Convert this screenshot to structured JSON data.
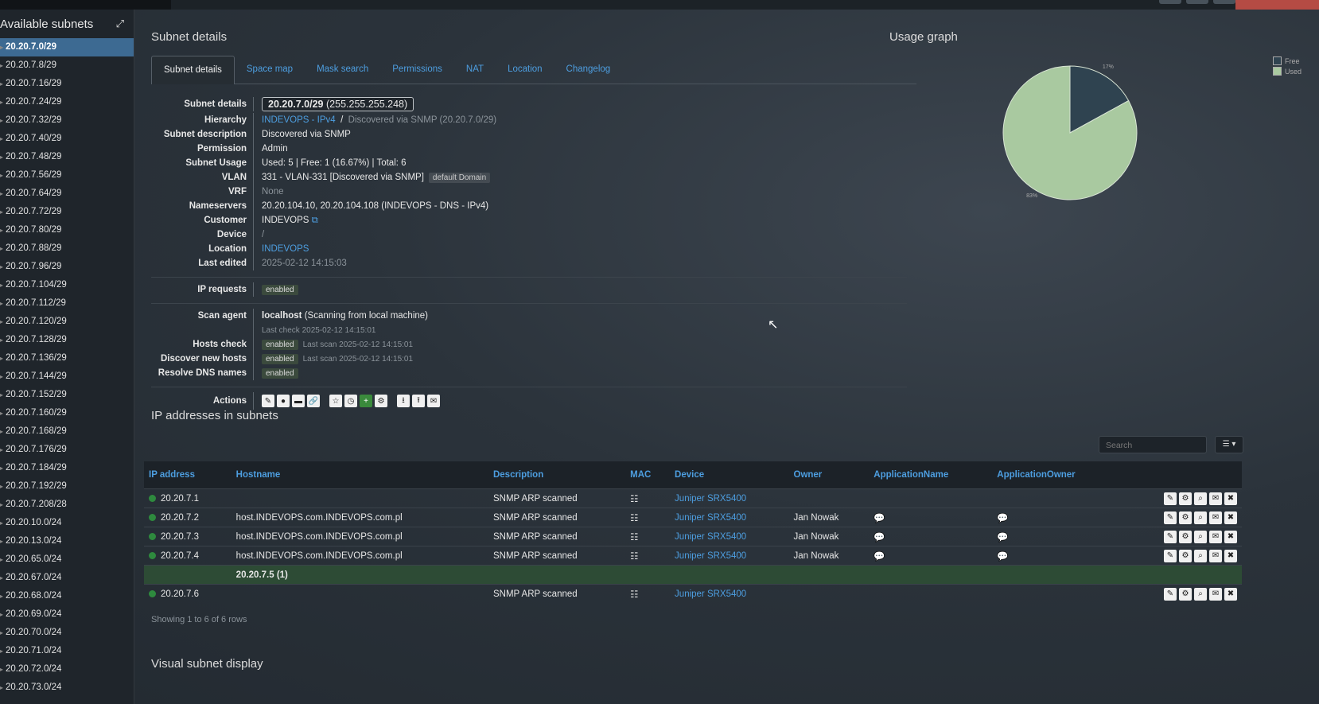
{
  "sidebar": {
    "title": "Available subnets",
    "expand_icon": "expand-icon",
    "subnets": [
      "20.20.7.0/29",
      "20.20.7.8/29",
      "20.20.7.16/29",
      "20.20.7.24/29",
      "20.20.7.32/29",
      "20.20.7.40/29",
      "20.20.7.48/29",
      "20.20.7.56/29",
      "20.20.7.64/29",
      "20.20.7.72/29",
      "20.20.7.80/29",
      "20.20.7.88/29",
      "20.20.7.96/29",
      "20.20.7.104/29",
      "20.20.7.112/29",
      "20.20.7.120/29",
      "20.20.7.128/29",
      "20.20.7.136/29",
      "20.20.7.144/29",
      "20.20.7.152/29",
      "20.20.7.160/29",
      "20.20.7.168/29",
      "20.20.7.176/29",
      "20.20.7.184/29",
      "20.20.7.192/29",
      "20.20.7.208/28",
      "20.20.10.0/24",
      "20.20.13.0/24",
      "20.20.65.0/24",
      "20.20.67.0/24",
      "20.20.68.0/24",
      "20.20.69.0/24",
      "20.20.70.0/24",
      "20.20.71.0/24",
      "20.20.72.0/24",
      "20.20.73.0/24"
    ],
    "active_index": 0
  },
  "details_title": "Subnet details",
  "tabs": [
    "Subnet details",
    "Space map",
    "Mask search",
    "Permissions",
    "NAT",
    "Location",
    "Changelog"
  ],
  "details": {
    "subnet_label": "Subnet details",
    "subnet": "20.20.7.0/29",
    "mask": "(255.255.255.248)",
    "hierarchy_label": "Hierarchy",
    "hierarchy_link": "INDEVOPS - IPv4",
    "hierarchy_sep": "/",
    "hierarchy_rest": "Discovered via SNMP (20.20.7.0/29)",
    "description_label": "Subnet description",
    "description": "Discovered via SNMP",
    "permission_label": "Permission",
    "permission": "Admin",
    "usage_label": "Subnet Usage",
    "usage": "Used: 5 | Free: 1 (16.67%) | Total: 6",
    "vlan_label": "VLAN",
    "vlan": "331 - VLAN-331 [Discovered via SNMP]",
    "vlan_domain": "default Domain",
    "vrf_label": "VRF",
    "vrf": "None",
    "nameservers_label": "Nameservers",
    "nameservers": "20.20.104.10, 20.20.104.108 (INDEVOPS - DNS - IPv4)",
    "customer_label": "Customer",
    "customer": "INDEVOPS",
    "device_label": "Device",
    "device": "/",
    "location_label": "Location",
    "location": "INDEVOPS",
    "last_edited_label": "Last edited",
    "last_edited": "2025-02-12 14:15:03",
    "ip_requests_label": "IP requests",
    "ip_requests": "enabled",
    "scan_agent_label": "Scan agent",
    "scan_agent": "localhost",
    "scan_agent_desc": "(Scanning from local machine)",
    "last_check": "Last check 2025-02-12 14:15:01",
    "hosts_check_label": "Hosts check",
    "hosts_check": "enabled",
    "hosts_check_scan": "Last scan 2025-02-12 14:15:01",
    "discover_label": "Discover new hosts",
    "discover": "enabled",
    "discover_scan": "Last scan 2025-02-12 14:15:01",
    "resolve_label": "Resolve DNS names",
    "resolve": "enabled",
    "actions_label": "Actions"
  },
  "usage_graph": {
    "title": "Usage graph",
    "legend": [
      "Free",
      "Used"
    ],
    "colors": {
      "free": "#2f4350",
      "used": "#a9c9a0"
    },
    "chart_data": {
      "type": "pie",
      "categories": [
        "Free",
        "Used"
      ],
      "values": [
        17,
        83
      ],
      "labels": [
        "17%",
        "83%"
      ]
    }
  },
  "ip_section": {
    "title": "IP addresses in subnets",
    "search_placeholder": "Search",
    "columns": [
      "IP address",
      "Hostname",
      "Description",
      "MAC",
      "Device",
      "Owner",
      "ApplicationName",
      "ApplicationOwner"
    ],
    "rows": [
      {
        "ip": "20.20.7.1",
        "hostname": "",
        "description": "SNMP ARP scanned",
        "device": "Juniper SRX5400",
        "owner": "",
        "app": false
      },
      {
        "ip": "20.20.7.2",
        "hostname": "host.INDEVOPS.com.INDEVOPS.com.pl",
        "description": "SNMP ARP scanned",
        "device": "Juniper SRX5400",
        "owner": "Jan Nowak",
        "app": true
      },
      {
        "ip": "20.20.7.3",
        "hostname": "host.INDEVOPS.com.INDEVOPS.com.pl",
        "description": "SNMP ARP scanned",
        "device": "Juniper SRX5400",
        "owner": "Jan Nowak",
        "app": true
      },
      {
        "ip": "20.20.7.4",
        "hostname": "host.INDEVOPS.com.INDEVOPS.com.pl",
        "description": "SNMP ARP scanned",
        "device": "Juniper SRX5400",
        "owner": "Jan Nowak",
        "app": true
      },
      {
        "gap": "20.20.7.5 (1)"
      },
      {
        "ip": "20.20.7.6",
        "hostname": "",
        "description": "SNMP ARP scanned",
        "device": "Juniper SRX5400",
        "owner": "",
        "app": false
      }
    ],
    "showing": "Showing 1 to 6 of 6 rows"
  },
  "visual_title": "Visual subnet display"
}
